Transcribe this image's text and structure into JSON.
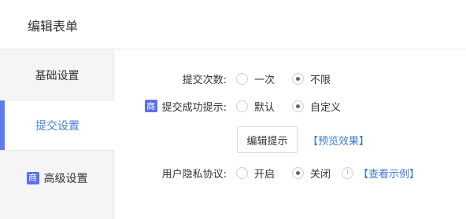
{
  "header": {
    "title": "编辑表单"
  },
  "sidebar": {
    "items": [
      {
        "label": "基础设置"
      },
      {
        "label": "提交设置"
      },
      {
        "label": "高级设置",
        "badge": "商"
      }
    ]
  },
  "form": {
    "submit_count": {
      "label": "提交次数:",
      "options": [
        "一次",
        "不限"
      ],
      "selected": "不限"
    },
    "submit_success": {
      "badge": "商",
      "label": "提交成功提示:",
      "options": [
        "默认",
        "自定义"
      ],
      "selected": "自定义",
      "edit_button": "编辑提示",
      "preview_link": "【预览效果】"
    },
    "privacy": {
      "label": "用户隐私协议:",
      "options": [
        "开启",
        "关闭"
      ],
      "selected": "关闭",
      "info_glyph": "i",
      "example_link": "【查看示例】"
    }
  },
  "colors": {
    "accent": "#5e7cf0",
    "link": "#3a7bd5",
    "badge": "#5b6ef0"
  }
}
